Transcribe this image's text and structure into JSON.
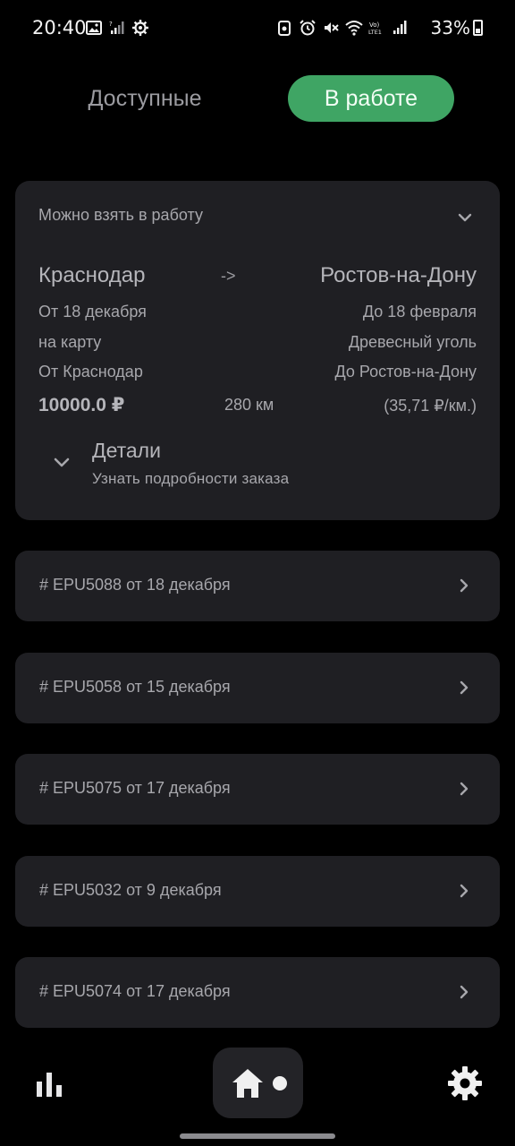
{
  "status_bar": {
    "time": "20:40",
    "battery": "33%",
    "left_icons": [
      "image-icon",
      "signal-off-icon",
      "gear-icon"
    ],
    "right_icons": [
      "shield-icon",
      "alarm-icon",
      "mute-icon",
      "wifi-icon",
      "lte-icon",
      "signal-icon"
    ]
  },
  "tabs": {
    "available": "Доступные",
    "in_work": "В работе",
    "active": "in_work",
    "active_color": "#3fa564"
  },
  "main_card": {
    "status": "Можно взять в работу",
    "from_city": "Краснодар",
    "arrow": "->",
    "to_city": "Ростов-на-Дону",
    "date_from": "От 18 декабря",
    "date_to": "До 18 февраля",
    "type": "на карту",
    "cargo": "Древесный уголь",
    "from_point": "От Краснодар",
    "to_point": "До Ростов-на-Дону",
    "price": "10000.0 ₽",
    "distance": "280 км",
    "rate": "(35,71 ₽/км.)",
    "details_title": "Детали",
    "details_subtitle": "Узнать подробности заказа"
  },
  "orders": [
    {
      "label": "# EPU5088 от 18 декабря"
    },
    {
      "label": "# EPU5058 от 15 декабря"
    },
    {
      "label": "# EPU5075 от 17 декабря"
    },
    {
      "label": "# EPU5032 от 9 декабря"
    },
    {
      "label": "# EPU5074 от 17 декабря"
    }
  ],
  "bottom_nav": {
    "items": [
      "stats-icon",
      "home-icon",
      "settings-icon"
    ],
    "active": "home-icon"
  }
}
